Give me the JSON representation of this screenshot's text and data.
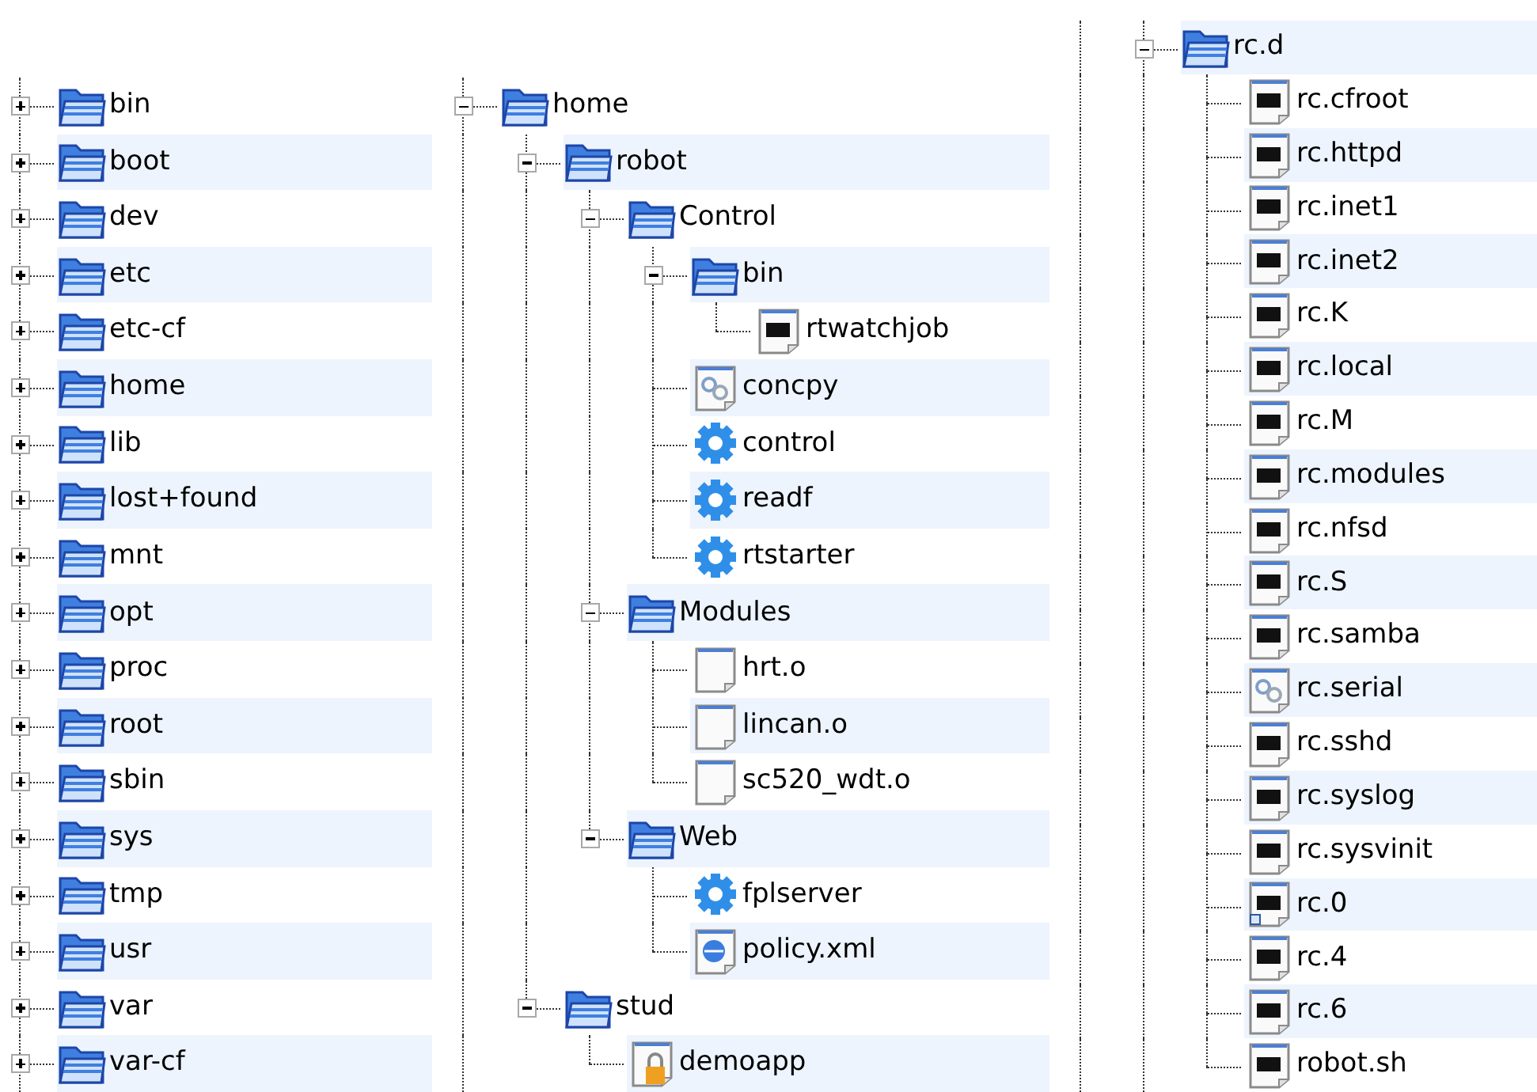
{
  "panels": [
    {
      "rows": [
        {
          "name": "bin",
          "kind": "folder",
          "expanded": false
        },
        {
          "name": "boot",
          "kind": "folder",
          "expanded": false
        },
        {
          "name": "dev",
          "kind": "folder",
          "expanded": false
        },
        {
          "name": "etc",
          "kind": "folder",
          "expanded": false
        },
        {
          "name": "etc-cf",
          "kind": "folder",
          "expanded": false
        },
        {
          "name": "home",
          "kind": "folder",
          "expanded": false
        },
        {
          "name": "lib",
          "kind": "folder",
          "expanded": false
        },
        {
          "name": "lost+found",
          "kind": "folder",
          "expanded": false
        },
        {
          "name": "mnt",
          "kind": "folder",
          "expanded": false
        },
        {
          "name": "opt",
          "kind": "folder",
          "expanded": false
        },
        {
          "name": "proc",
          "kind": "folder",
          "expanded": false
        },
        {
          "name": "root",
          "kind": "folder",
          "expanded": false
        },
        {
          "name": "sbin",
          "kind": "folder",
          "expanded": false
        },
        {
          "name": "sys",
          "kind": "folder",
          "expanded": false
        },
        {
          "name": "tmp",
          "kind": "folder",
          "expanded": false
        },
        {
          "name": "usr",
          "kind": "folder",
          "expanded": false
        },
        {
          "name": "var",
          "kind": "folder",
          "expanded": false
        },
        {
          "name": "var-cf",
          "kind": "folder",
          "expanded": false
        }
      ]
    },
    {
      "rows": [
        {
          "name": "home",
          "kind": "folder",
          "expanded": true,
          "children": [
            {
              "name": "robot",
              "kind": "folder",
              "expanded": true,
              "children": [
                {
                  "name": "Control",
                  "kind": "folder",
                  "expanded": true,
                  "children": [
                    {
                      "name": "bin",
                      "kind": "folder",
                      "expanded": true,
                      "children": [
                        {
                          "name": "rtwatchjob",
                          "kind": "executable"
                        }
                      ]
                    },
                    {
                      "name": "concpy",
                      "kind": "script"
                    },
                    {
                      "name": "control",
                      "kind": "service"
                    },
                    {
                      "name": "readf",
                      "kind": "service"
                    },
                    {
                      "name": "rtstarter",
                      "kind": "service"
                    }
                  ]
                },
                {
                  "name": "Modules",
                  "kind": "folder",
                  "expanded": true,
                  "children": [
                    {
                      "name": "hrt.o",
                      "kind": "object"
                    },
                    {
                      "name": "lincan.o",
                      "kind": "object"
                    },
                    {
                      "name": "sc520_wdt.o",
                      "kind": "object"
                    }
                  ]
                },
                {
                  "name": "Web",
                  "kind": "folder",
                  "expanded": true,
                  "children": [
                    {
                      "name": "fplserver",
                      "kind": "service"
                    },
                    {
                      "name": "policy.xml",
                      "kind": "xml"
                    }
                  ]
                }
              ]
            },
            {
              "name": "stud",
              "kind": "folder",
              "expanded": true,
              "children": [
                {
                  "name": "demoapp",
                  "kind": "locked"
                }
              ]
            }
          ]
        }
      ]
    },
    {
      "rows": [
        {
          "name": "rc.d",
          "kind": "folder",
          "expanded": true,
          "children": [
            {
              "name": "rc.cfroot",
              "kind": "executable"
            },
            {
              "name": "rc.httpd",
              "kind": "executable"
            },
            {
              "name": "rc.inet1",
              "kind": "executable"
            },
            {
              "name": "rc.inet2",
              "kind": "executable"
            },
            {
              "name": "rc.K",
              "kind": "executable"
            },
            {
              "name": "rc.local",
              "kind": "executable"
            },
            {
              "name": "rc.M",
              "kind": "executable"
            },
            {
              "name": "rc.modules",
              "kind": "executable"
            },
            {
              "name": "rc.nfsd",
              "kind": "executable"
            },
            {
              "name": "rc.S",
              "kind": "executable"
            },
            {
              "name": "rc.samba",
              "kind": "executable"
            },
            {
              "name": "rc.serial",
              "kind": "script"
            },
            {
              "name": "rc.sshd",
              "kind": "executable"
            },
            {
              "name": "rc.syslog",
              "kind": "executable"
            },
            {
              "name": "rc.sysvinit",
              "kind": "executable"
            },
            {
              "name": "rc.0",
              "kind": "executable_link"
            },
            {
              "name": "rc.4",
              "kind": "executable"
            },
            {
              "name": "rc.6",
              "kind": "executable"
            },
            {
              "name": "robot.sh",
              "kind": "executable"
            }
          ]
        }
      ]
    }
  ]
}
